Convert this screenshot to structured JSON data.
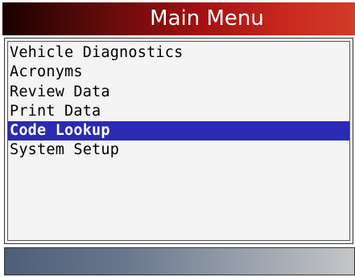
{
  "header": {
    "title": "Main Menu"
  },
  "menu": {
    "selected_index": 4,
    "items": [
      {
        "label": "Vehicle Diagnostics"
      },
      {
        "label": "Acronyms"
      },
      {
        "label": "Review Data"
      },
      {
        "label": "Print Data"
      },
      {
        "label": "Code Lookup"
      },
      {
        "label": "System Setup"
      }
    ]
  },
  "colors": {
    "selection": "#2a2ab4",
    "title_bar_start": "#1a0000",
    "title_bar_end": "#d23c28"
  }
}
